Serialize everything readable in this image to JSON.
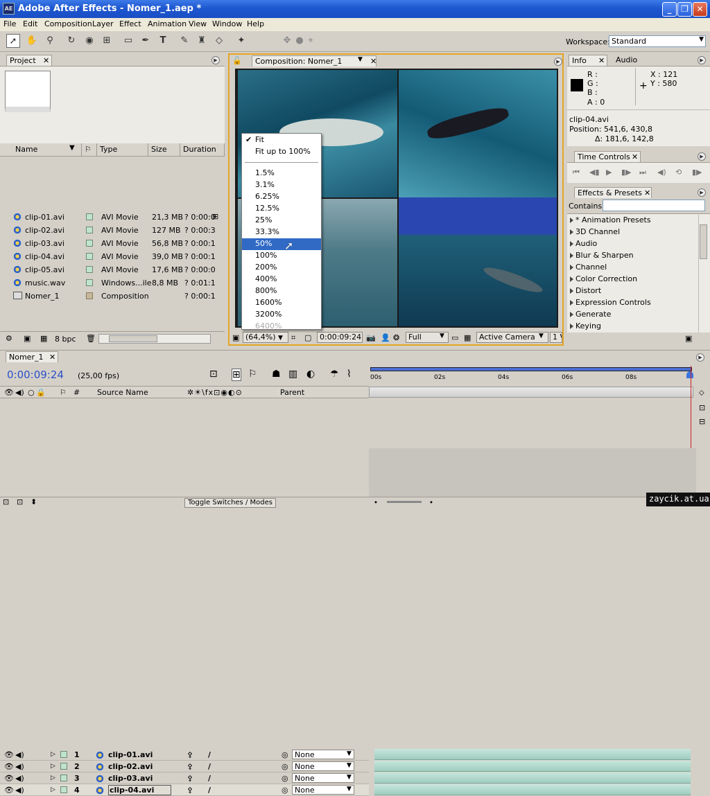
{
  "app": {
    "title": "Adobe After Effects - Nomer_1.aep *",
    "logo": "AE"
  },
  "window_controls": {
    "minimize": "_",
    "maximize": "❐",
    "close": "✕"
  },
  "menu": [
    "File",
    "Edit",
    "Composition",
    "Layer",
    "Effect",
    "Animation",
    "View",
    "Window",
    "Help"
  ],
  "toolbar": {
    "workspace_label": "Workspace:",
    "workspace_value": "Standard"
  },
  "project": {
    "tab": "Project",
    "cols": [
      "Name",
      "Type",
      "Size",
      "Duration"
    ],
    "items": [
      {
        "name": "clip-01.avi",
        "type": "AVI Movie",
        "size": "21,3 MB",
        "duration": "? 0:00:0"
      },
      {
        "name": "clip-02.avi",
        "type": "AVI Movie",
        "size": "127 MB",
        "duration": "? 0:00:3"
      },
      {
        "name": "clip-03.avi",
        "type": "AVI Movie",
        "size": "56,8 MB",
        "duration": "? 0:00:1"
      },
      {
        "name": "clip-04.avi",
        "type": "AVI Movie",
        "size": "39,0 MB",
        "duration": "? 0:00:1"
      },
      {
        "name": "clip-05.avi",
        "type": "AVI Movie",
        "size": "17,6 MB",
        "duration": "? 0:00:0"
      },
      {
        "name": "music.wav",
        "type": "Windows...ile",
        "size": "8,8 MB",
        "duration": "? 0:01:1"
      },
      {
        "name": "Nomer_1",
        "type": "Composition",
        "size": "",
        "duration": "? 0:00:1"
      }
    ],
    "bpc": "8 bpc"
  },
  "comp": {
    "tab": "Composition: Nomer_1",
    "zoom": "(64,4%)",
    "timecode": "0:00:09:24",
    "resolution": "Full",
    "camera": "Active Camera",
    "views": "1 V"
  },
  "zoom_menu": {
    "items": [
      {
        "label": "Fit",
        "checked": true
      },
      {
        "label": "Fit up to 100%"
      },
      {
        "sep": true
      },
      {
        "label": "1.5%"
      },
      {
        "label": "3.1%"
      },
      {
        "label": "6.25%"
      },
      {
        "label": "12.5%"
      },
      {
        "label": "25%"
      },
      {
        "label": "33.3%"
      },
      {
        "label": "50%",
        "highlighted": true
      },
      {
        "label": "100%"
      },
      {
        "label": "200%"
      },
      {
        "label": "400%"
      },
      {
        "label": "800%"
      },
      {
        "label": "1600%"
      },
      {
        "label": "3200%"
      },
      {
        "label": "6400%",
        "disabled": true
      }
    ]
  },
  "info": {
    "tab_info": "Info",
    "tab_audio": "Audio",
    "r": "R :",
    "g": "G :",
    "b": "B :",
    "a": "A : 0",
    "x": "X : 121",
    "y": "Y : 580",
    "clip": "clip-04.avi",
    "position": "Position: 541,6, 430,8",
    "delta": "Δ: 181,6, 142,8"
  },
  "time_controls": {
    "tab": "Time Controls"
  },
  "effects": {
    "tab": "Effects & Presets",
    "contains_label": "Contains:",
    "items": [
      "* Animation Presets",
      "3D Channel",
      "Audio",
      "Blur & Sharpen",
      "Channel",
      "Color Correction",
      "Distort",
      "Expression Controls",
      "Generate",
      "Keying"
    ]
  },
  "timeline": {
    "tab": "Nomer_1",
    "timecode": "0:00:09:24",
    "fps": "(25,00 fps)",
    "col_num": "#",
    "col_source": "Source Name",
    "col_parent": "Parent",
    "ruler": [
      "00s",
      "02s",
      "04s",
      "06s",
      "08s"
    ],
    "layers": [
      {
        "num": "1",
        "name": "clip-01.avi",
        "parent": "None"
      },
      {
        "num": "2",
        "name": "clip-02.avi",
        "parent": "None"
      },
      {
        "num": "3",
        "name": "clip-03.avi",
        "parent": "None"
      },
      {
        "num": "4",
        "name": "clip-04.avi",
        "parent": "None"
      }
    ],
    "toggle_label": "Toggle Switches / Modes"
  },
  "watermark": "zaycik.at.ua"
}
